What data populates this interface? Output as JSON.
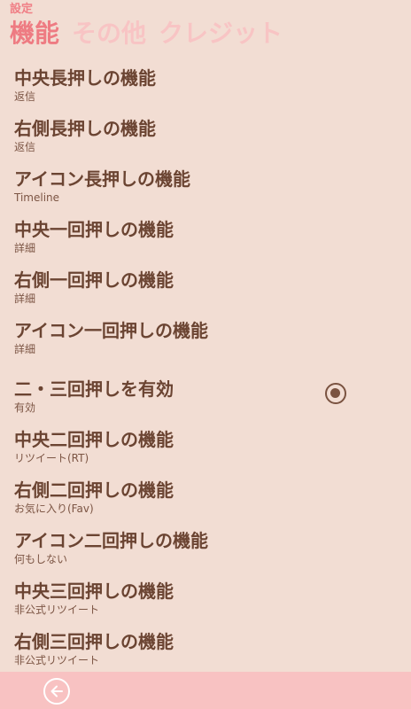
{
  "header": {
    "app_title": "設定",
    "tabs": [
      {
        "label": "機能",
        "active": true
      },
      {
        "label": "その他",
        "active": false
      },
      {
        "label": "クレジット",
        "active": false
      }
    ]
  },
  "settings": [
    {
      "name": "中央長押しの機能",
      "value": "返信"
    },
    {
      "name": "右側長押しの機能",
      "value": "返信"
    },
    {
      "name": "アイコン長押しの機能",
      "value": "Timeline"
    },
    {
      "name": "中央一回押しの機能",
      "value": "詳細"
    },
    {
      "name": "右側一回押しの機能",
      "value": "詳細"
    },
    {
      "name": "アイコン一回押しの機能",
      "value": "詳細"
    },
    {
      "name": "二・三回押しを有効",
      "value": "有効",
      "toggle": true,
      "checked": true
    },
    {
      "name": "中央二回押しの機能",
      "value": "リツイート(RT)"
    },
    {
      "name": "右側二回押しの機能",
      "value": "お気に入り(Fav)"
    },
    {
      "name": "アイコン二回押しの機能",
      "value": "何もしない"
    },
    {
      "name": "中央三回押しの機能",
      "value": "非公式リツイート"
    },
    {
      "name": "右側三回押しの機能",
      "value": "非公式リツイート"
    }
  ],
  "app_bar": {
    "back_icon": "back-arrow-icon"
  },
  "colors": {
    "background": "#f2ddd3",
    "accent": "#ee7b82",
    "inactive_tab": "#f8c4c4",
    "text": "#6b4432",
    "app_bar": "#f8c2c2"
  }
}
